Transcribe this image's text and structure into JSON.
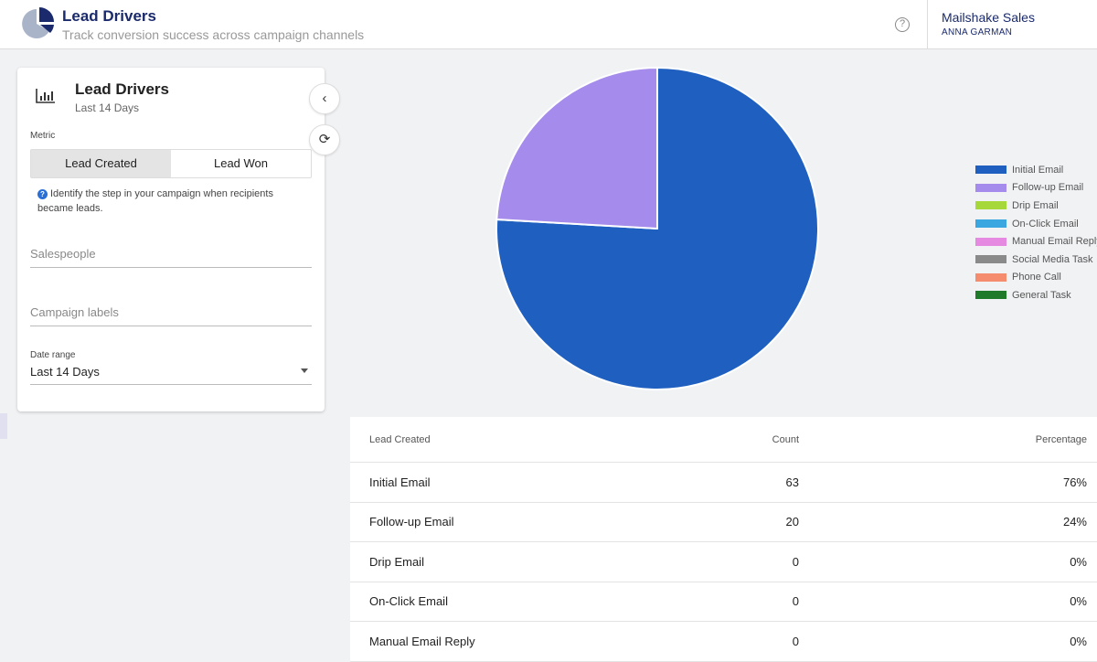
{
  "header": {
    "title": "Lead Drivers",
    "subtitle": "Track conversion success across campaign channels",
    "account": "Mailshake Sales",
    "user": "ANNA GARMAN",
    "help_icon": "question-circle-icon"
  },
  "panel": {
    "title": "Lead Drivers",
    "subtitle": "Last 14 Days",
    "metric_label": "Metric",
    "metric_options": [
      "Lead Created",
      "Lead Won"
    ],
    "selected_metric": "Lead Created",
    "hint": "Identify the step in your campaign when recipients became leads.",
    "salespeople_placeholder": "Salespeople",
    "campaign_labels_placeholder": "Campaign labels",
    "date_range_label": "Date range",
    "date_range_value": "Last 14 Days",
    "collapse_icon": "chevron-left-icon",
    "refresh_icon": "refresh-icon"
  },
  "chart_data": {
    "type": "pie",
    "categories": [
      "Initial Email",
      "Follow-up Email",
      "Drip Email",
      "On-Click Email",
      "Manual Email Reply",
      "Social Media Task",
      "Phone Call",
      "General Task"
    ],
    "values": [
      63,
      20,
      0,
      0,
      0,
      0,
      0,
      0
    ],
    "colors": [
      "#1f5fbf",
      "#a58bec",
      "#a6d83a",
      "#3aa7e0",
      "#e58ae0",
      "#8a8a8a",
      "#f58c6e",
      "#1f7a2a"
    ],
    "legend": "right"
  },
  "table": {
    "headers": [
      "Lead Created",
      "Count",
      "Percentage"
    ],
    "rows": [
      [
        "Initial Email",
        "63",
        "76%"
      ],
      [
        "Follow-up Email",
        "20",
        "24%"
      ],
      [
        "Drip Email",
        "0",
        "0%"
      ],
      [
        "On-Click Email",
        "0",
        "0%"
      ],
      [
        "Manual Email Reply",
        "0",
        "0%"
      ]
    ]
  }
}
